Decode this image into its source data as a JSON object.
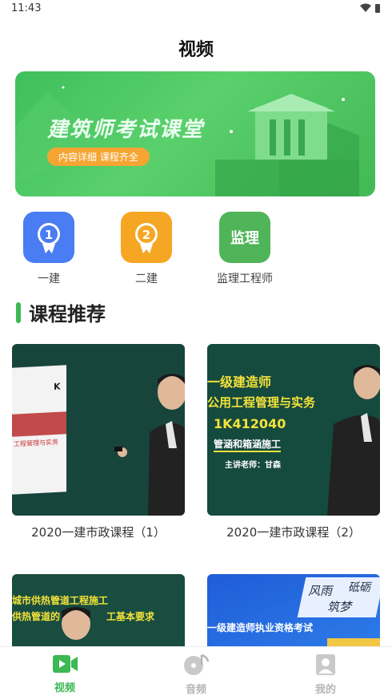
{
  "status": {
    "time": "11:43",
    "wifi_icon": "wifi-icon",
    "battery_icon": "battery-icon"
  },
  "page": {
    "title": "视频"
  },
  "banner": {
    "title": "建筑师考试课堂",
    "subtitle": "内容详细 课程齐全"
  },
  "categories": [
    {
      "label": "一建",
      "icon": "medal-1-icon",
      "icon_text": "1",
      "color": "#4a7df3"
    },
    {
      "label": "二建",
      "icon": "medal-2-icon",
      "icon_text": "2",
      "color": "#f5a623"
    },
    {
      "label": "监理工程师",
      "icon": "supervision-icon",
      "icon_text": "监理",
      "color": "#4fb558"
    }
  ],
  "section": {
    "title": "课程推荐"
  },
  "courses": [
    {
      "title": "2020一建市政课程（1）",
      "thumb_text": [
        "K",
        "工程管理与实务"
      ]
    },
    {
      "title": "2020一建市政课程（2）",
      "thumb_text": [
        "一级建造师",
        "公用工程管理与实务",
        "1K412040",
        "管涵和箱涵施工",
        "主讲老师：甘森"
      ]
    },
    {
      "title": "",
      "thumb_text": [
        "城市供热管道工程施工",
        "供热管道的",
        "工基本要求"
      ]
    },
    {
      "title": "",
      "thumb_text": [
        "一级建造师执业资格考试",
        "风雨",
        "砥砺",
        "筑梦"
      ]
    }
  ],
  "tabs": [
    {
      "label": "视频",
      "icon": "video-icon",
      "active": true
    },
    {
      "label": "音频",
      "icon": "music-icon",
      "active": false
    },
    {
      "label": "我的",
      "icon": "profile-icon",
      "active": false
    }
  ],
  "colors": {
    "accent": "#3cb854",
    "inactive": "#b5b5b5"
  }
}
